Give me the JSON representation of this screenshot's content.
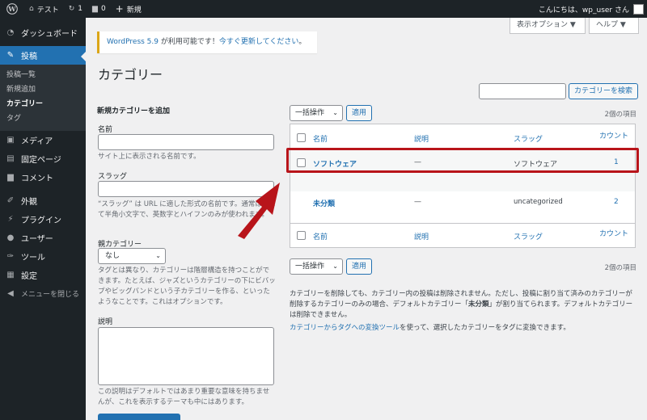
{
  "adminbar": {
    "site_name": "テスト",
    "updates_count": "1",
    "comments_count": "0",
    "new_label": "新規",
    "greeting": "こんにちは、wp_user さん"
  },
  "sidebar": {
    "items": [
      {
        "label": "ダッシュボード",
        "icon": "dashboard-icon"
      },
      {
        "label": "投稿",
        "icon": "pin-icon"
      },
      {
        "label": "メディア",
        "icon": "media-icon"
      },
      {
        "label": "固定ページ",
        "icon": "page-icon"
      },
      {
        "label": "コメント",
        "icon": "comment-icon"
      },
      {
        "label": "外観",
        "icon": "appearance-icon"
      },
      {
        "label": "プラグイン",
        "icon": "plugin-icon"
      },
      {
        "label": "ユーザー",
        "icon": "user-icon"
      },
      {
        "label": "ツール",
        "icon": "tool-icon"
      },
      {
        "label": "設定",
        "icon": "settings-icon"
      },
      {
        "label": "メニューを閉じる",
        "icon": "collapse-icon"
      }
    ],
    "submenu": [
      "投稿一覧",
      "新規追加",
      "カテゴリー",
      "タグ"
    ]
  },
  "header": {
    "screen_options": "表示オプション ▼",
    "help": "ヘルプ ▼",
    "notice_link1": "WordPress 5.9",
    "notice_mid": " が利用可能です！",
    "notice_link2": "今すぐ更新してください",
    "notice_end": "。",
    "page_title": "カテゴリー",
    "search_button": "カテゴリーを検索"
  },
  "form": {
    "heading": "新規カテゴリーを追加",
    "name_label": "名前",
    "name_desc": "サイト上に表示される名前です。",
    "slug_label": "スラッグ",
    "slug_desc": "“スラッグ” は URL に適した形式の名前です。通常はすべて半角小文字で、英数字とハイフンのみが使われます。",
    "parent_label": "親カテゴリー",
    "parent_value": "なし",
    "parent_desc": "タグとは異なり、カテゴリーは階層構造を持つことができます。たとえば、ジャズというカテゴリーの下にビバップやビッグバンドという子カテゴリーを作る、といったようなことです。これはオプションです。",
    "description_label": "説明",
    "description_desc": "この説明はデフォルトではあまり重要な意味を持ちませんが、これを表示するテーマも中にはあります。"
  },
  "list": {
    "bulk_action": "一括操作",
    "apply": "適用",
    "item_count": "2個の項目",
    "columns": {
      "name": "名前",
      "description": "説明",
      "slug": "スラッグ",
      "count": "カウント"
    },
    "rows": [
      {
        "name": "ソフトウェア",
        "description": "—",
        "slug": "ソフトウェア",
        "count": "1"
      },
      {
        "name": "未分類",
        "description": "—",
        "slug": "uncategorized",
        "count": "2"
      }
    ],
    "note1_a": "カテゴリーを削除しても、カテゴリー内の投稿は削除されません。ただし、投稿に割り当て済みのカテゴリーが削除するカテゴリーのみの場合、デフォルトカテゴリー「",
    "note1_b": "未分類",
    "note1_c": "」が割り当てられます。デフォルトカテゴリーは削除できません。",
    "note2_link": "カテゴリーからタグへの変換ツール",
    "note2_rest": "を使って、選択したカテゴリーをタグに変換できます。"
  },
  "colors": {
    "accent": "#2271b1",
    "highlight": "#b8141a",
    "adminbar": "#1d2327"
  }
}
